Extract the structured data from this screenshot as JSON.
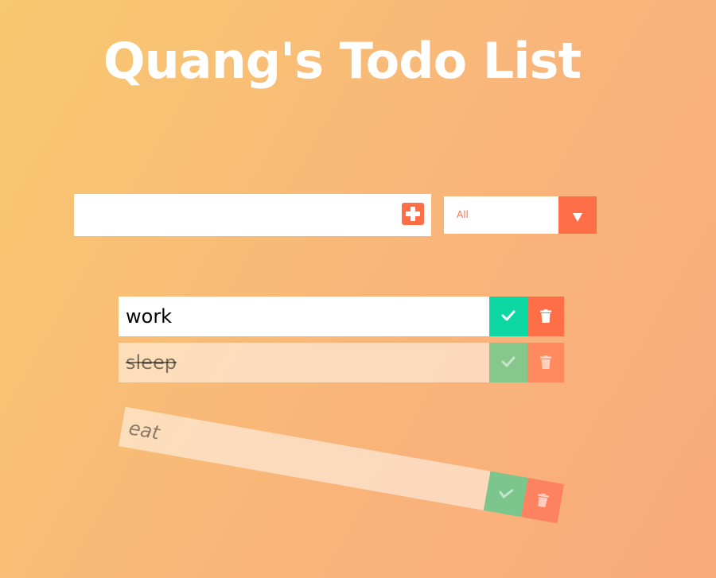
{
  "page": {
    "title": "Quang's Todo List"
  },
  "form": {
    "input_value": "",
    "input_placeholder": "",
    "add_icon": "plus-square-icon"
  },
  "filter": {
    "selected": "All",
    "arrow_icon": "triangle-down-icon"
  },
  "todos": [
    {
      "text": "work",
      "state": "active"
    },
    {
      "text": "sleep",
      "state": "completed"
    },
    {
      "text": "eat",
      "state": "deleting"
    }
  ],
  "icons": {
    "complete": "check-icon",
    "delete": "trash-icon"
  },
  "colors": {
    "accent": "#ff6f47",
    "complete": "#0dd7a2",
    "background_start": "#f7c970",
    "background_end": "#faab7c",
    "title": "#ffffff"
  }
}
